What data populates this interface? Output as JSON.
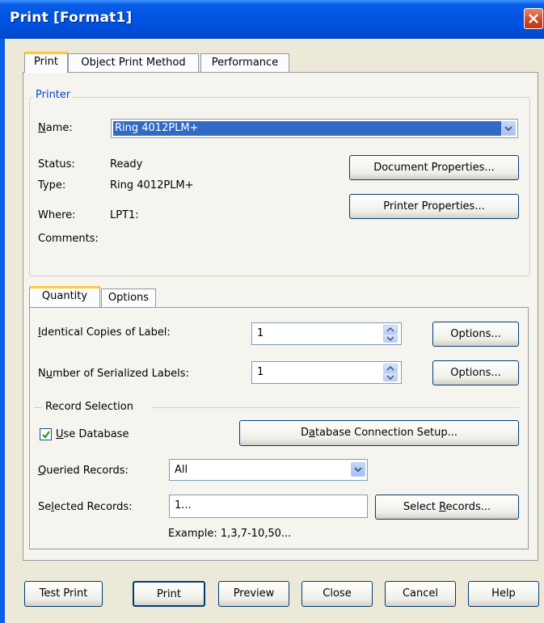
{
  "window": {
    "title": "Print [Format1]"
  },
  "tabs": [
    {
      "label": "Print"
    },
    {
      "label": "Object Print Method"
    },
    {
      "label": "Performance"
    }
  ],
  "printer": {
    "group_label": "Printer",
    "name_label": "Name:",
    "name_value": "Ring 4012PLM+",
    "status_label": "Status:",
    "status_value": "Ready",
    "type_label": "Type:",
    "type_value": "Ring 4012PLM+",
    "where_label": "Where:",
    "where_value": "LPT1:",
    "comments_label": "Comments:",
    "document_properties_label": "Document Properties...",
    "printer_properties_label": "Printer Properties..."
  },
  "subtabs": [
    {
      "label": "Quantity"
    },
    {
      "label": "Options"
    }
  ],
  "quantity": {
    "identical_copies_label": "Identical Copies of Label:",
    "identical_copies_value": "1",
    "serialized_labels_label": "Number of Serialized Labels:",
    "serialized_labels_value": "1",
    "options_label": "Options...",
    "record_selection_label": "Record Selection",
    "use_database_label": "Use Database",
    "use_database_checked": true,
    "db_connection_label": "Database Connection Setup...",
    "queried_records_label": "Queried Records:",
    "queried_records_value": "All",
    "selected_records_label": "Selected Records:",
    "selected_records_value": "1...",
    "select_records_label": "Select Records...",
    "example_text": "Example: 1,3,7-10,50..."
  },
  "footer": {
    "test_print": "Test Print",
    "print": "Print",
    "preview": "Preview",
    "close": "Close",
    "cancel": "Cancel",
    "help": "Help"
  },
  "colors": {
    "titlebar": "#0054e3",
    "accent_tab": "#ffc83c",
    "group_legend": "#0046d5",
    "selection": "#316ac5"
  }
}
